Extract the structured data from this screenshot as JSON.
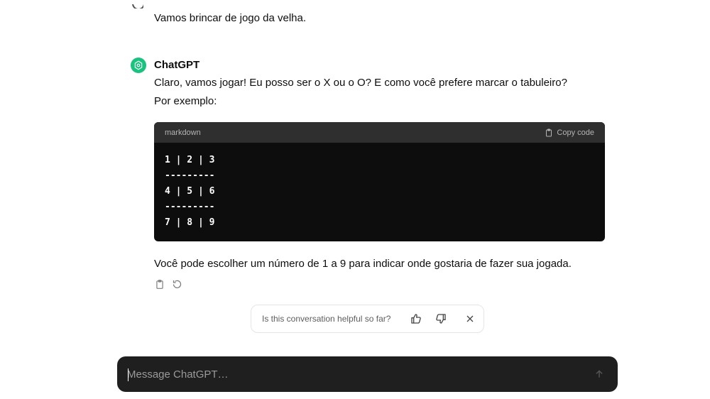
{
  "conversation": {
    "user_message": "Vamos brincar de jogo da velha.",
    "assistant": {
      "name": "ChatGPT",
      "intro": "Claro, vamos jogar! Eu posso ser o X ou o O? E como você prefere marcar o tabuleiro? Por exemplo:",
      "code_block": {
        "language": "markdown",
        "copy_label": "Copy code",
        "lines": [
          "1 | 2 | 3",
          "---------",
          "4 | 5 | 6",
          "---------",
          "7 | 8 | 9"
        ]
      },
      "outro": "Você pode escolher um número de 1 a 9 para indicar onde gostaria de fazer sua jogada.",
      "actions": {
        "copy_icon": "clipboard-icon",
        "regenerate_icon": "regenerate-icon"
      }
    }
  },
  "feedback": {
    "question": "Is this conversation helpful so far?",
    "thumbs_up_icon": "thumbs-up-icon",
    "thumbs_down_icon": "thumbs-down-icon",
    "close_icon": "close-icon"
  },
  "composer": {
    "placeholder": "Message ChatGPT…",
    "send_icon": "arrow-up-icon"
  },
  "colors": {
    "assistant_avatar": "#19c37d",
    "code_background": "#0d0d0d",
    "code_header": "#2f2f2f",
    "composer_background": "#1f1f1f"
  }
}
